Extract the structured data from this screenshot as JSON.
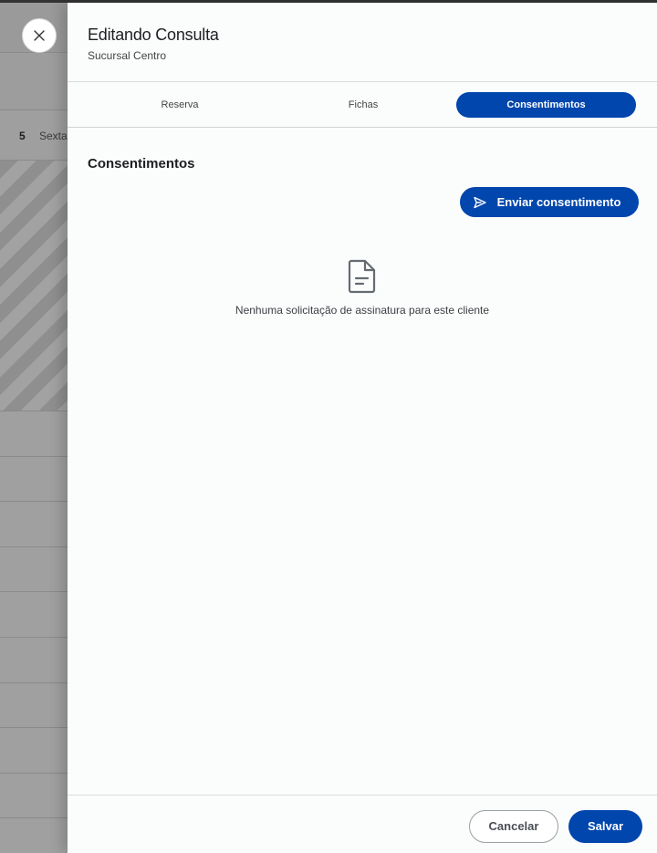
{
  "background": {
    "day_number": "5",
    "day_name": "Sexta"
  },
  "drawer": {
    "title": "Editando Consulta",
    "subtitle": "Sucursal Centro",
    "tabs": [
      {
        "label": "Reserva"
      },
      {
        "label": "Fichas"
      },
      {
        "label": "Consentimentos",
        "active": true
      }
    ],
    "section_title": "Consentimentos",
    "send_button": "Enviar consentimento",
    "empty_state": "Nenhuma solicitação de assinatura para este cliente"
  },
  "footer": {
    "cancel_label": "Cancelar",
    "save_label": "Salvar"
  },
  "colors": {
    "accent": "#0046ad"
  },
  "icons": {
    "close": "close-icon",
    "send": "send-icon",
    "empty": "document-icon"
  }
}
